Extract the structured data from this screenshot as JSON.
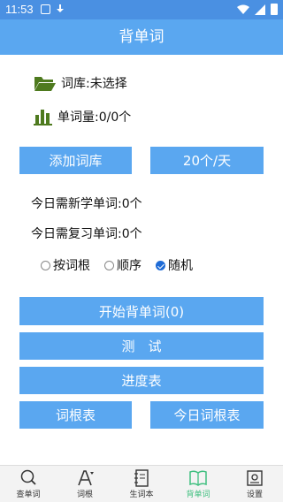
{
  "status": {
    "time": "11:53"
  },
  "header": {
    "title": "背单词"
  },
  "library": {
    "label": "词库:未选择"
  },
  "word_count": {
    "label": "单词量:0/0个"
  },
  "buttons": {
    "add_library": "添加词库",
    "per_day": "20个/天",
    "start": "开始背单词(0)",
    "test": "测　试",
    "progress": "进度表",
    "root_table": "词根表",
    "today_root_table": "今日词根表"
  },
  "today": {
    "new_words": "今日需新学单词:0个",
    "review_words": "今日需复习单词:0个"
  },
  "order": {
    "options": [
      "按词根",
      "顺序",
      "随机"
    ],
    "selected": "随机"
  },
  "nav": {
    "items": [
      {
        "label": "查单词",
        "icon": "search-icon"
      },
      {
        "label": "词根",
        "icon": "font-icon"
      },
      {
        "label": "生词本",
        "icon": "notebook-icon"
      },
      {
        "label": "背单词",
        "icon": "book-icon"
      },
      {
        "label": "设置",
        "icon": "settings-icon"
      }
    ],
    "active": "背单词"
  },
  "colors": {
    "header": "#5aa7f0",
    "status_bar": "#4a90e2",
    "button": "#5aa7f0",
    "active_nav": "#3fbf7f",
    "icon_green": "#4e7a1e"
  }
}
